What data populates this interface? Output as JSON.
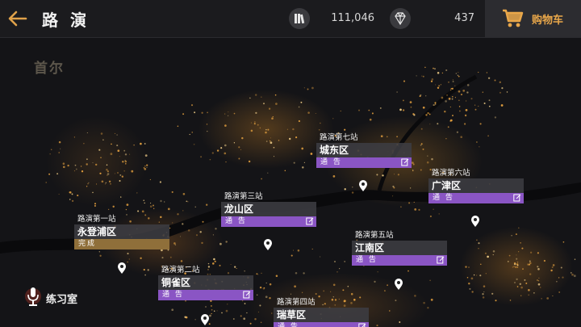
{
  "header": {
    "title": "路 演",
    "album_count": "111,046",
    "diamond_count": "437",
    "cart_label": "购物车"
  },
  "map": {
    "city_label": "首尔"
  },
  "stations": [
    {
      "tag": "路演第一站",
      "district": "永登浦区",
      "status": "完成",
      "status_type": "done"
    },
    {
      "tag": "路演第二站",
      "district": "铜雀区",
      "status": "通 告",
      "status_type": "notice"
    },
    {
      "tag": "路演第三站",
      "district": "龙山区",
      "status": "通 告",
      "status_type": "notice"
    },
    {
      "tag": "路演第四站",
      "district": "瑞草区",
      "status": "通 告",
      "status_type": "notice"
    },
    {
      "tag": "路演第五站",
      "district": "江南区",
      "status": "通 告",
      "status_type": "notice"
    },
    {
      "tag": "路演第六站",
      "district": "广津区",
      "status": "通 告",
      "status_type": "notice"
    },
    {
      "tag": "路演第七站",
      "district": "城东区",
      "status": "通 告",
      "status_type": "notice"
    }
  ],
  "practice": {
    "label": "练习室"
  },
  "colors": {
    "accent_gold": "#e9a74a",
    "notice_purple": "#8a55c4",
    "done_bronze": "#8f6f3a"
  },
  "icons": [
    "back-arrow-icon",
    "album-icon",
    "diamond-icon",
    "cart-icon",
    "note-icon",
    "location-pin-icon",
    "microphone-icon"
  ]
}
